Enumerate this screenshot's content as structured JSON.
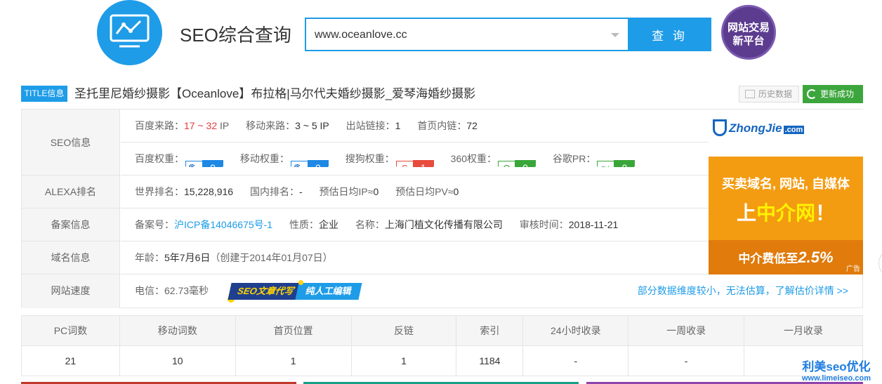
{
  "header": {
    "brand_title": "SEO综合查询",
    "search_value": "www.oceanlove.cc",
    "search_button": "查 询",
    "badge_line1": "网站交易",
    "badge_line2": "新平台"
  },
  "title_row": {
    "tag": "TITLE信息",
    "site_title": "圣托里尼婚纱摄影【Oceanlove】布拉格|马尔代夫婚纱摄影_爱琴海婚纱摄影",
    "history_label": "历史数据",
    "update_label": "更新成功"
  },
  "seo_info": {
    "label": "SEO信息",
    "baidu_source_label": "百度来路：",
    "baidu_source_value": "17 ~ 32",
    "baidu_source_unit": "IP",
    "mobile_source_label": "移动来路：",
    "mobile_source_value": "3 ~ 5 IP",
    "outbound_label": "出站链接：",
    "outbound_value": "1",
    "home_inner_label": "首页内链：",
    "home_inner_value": "72",
    "ranks": [
      {
        "label": "百度权重：",
        "icon": "paw-icon",
        "glyph": "🐾",
        "value": "0",
        "color": "blue"
      },
      {
        "label": "移动权重：",
        "icon": "paw-icon",
        "glyph": "🐾",
        "value": "0",
        "color": "blue"
      },
      {
        "label": "搜狗权重：",
        "icon": "sogou-icon",
        "glyph": "S",
        "value": "1",
        "color": "red"
      },
      {
        "label": "360权重：",
        "icon": "360-icon",
        "glyph": "O",
        "value": "0",
        "color": "green"
      },
      {
        "label": "谷歌PR：",
        "icon": "google-plus-icon",
        "glyph": "g+",
        "value": "0",
        "color": "green"
      }
    ]
  },
  "alexa": {
    "label": "ALEXA排名",
    "world_label": "世界排名：",
    "world_value": "15,228,916",
    "domestic_label": "国内排名：",
    "domestic_value": "-",
    "ip_label": "预估日均IP≈",
    "ip_value": "0",
    "pv_label": "预估日均PV≈",
    "pv_value": "0"
  },
  "icp": {
    "label": "备案信息",
    "number_label": "备案号：",
    "number_value": "沪ICP备14046675号-1",
    "nature_label": "性质：",
    "nature_value": "企业",
    "name_label": "名称：",
    "name_value": "上海门植文化传播有限公司",
    "audit_label": "审核时间：",
    "audit_value": "2018-11-21"
  },
  "domain": {
    "label": "域名信息",
    "age_label": "年龄：",
    "age_value": "5年7月6日",
    "created_text": "（创建于2014年01月07日）"
  },
  "speed": {
    "label": "网站速度",
    "telecom_label": "电信：",
    "telecom_value": "62.73毫秒",
    "banner_part1": "SEO文章代写",
    "banner_part2": "纯人工编辑",
    "detail_link": "部分数据维度较小，无法估算，了解估价详情 >>"
  },
  "ad": {
    "logo": "ZhongJie",
    "logo_suffix": ".com",
    "line1": "买卖域名, 网站, 自媒体",
    "line2_a": "上",
    "line2_b": "中介网",
    "line2_c": "！",
    "line3_a": "中介费低至",
    "line3_b": "2.5%",
    "tag": "广告"
  },
  "stats": {
    "headers": [
      "PC词数",
      "移动词数",
      "首页位置",
      "反链",
      "索引",
      "24小时收录",
      "一周收录",
      "一月收录"
    ],
    "values": [
      "21",
      "10",
      "1",
      "1",
      "1184",
      "-",
      "-",
      ""
    ]
  },
  "watermark": {
    "line1": "利美seo优化",
    "line2": "www.limeiseo.com"
  },
  "colors": {
    "accent": "#1e9ce8",
    "success": "#3ca63c",
    "danger": "#e23c3c",
    "ad_orange": "#f39c12"
  }
}
